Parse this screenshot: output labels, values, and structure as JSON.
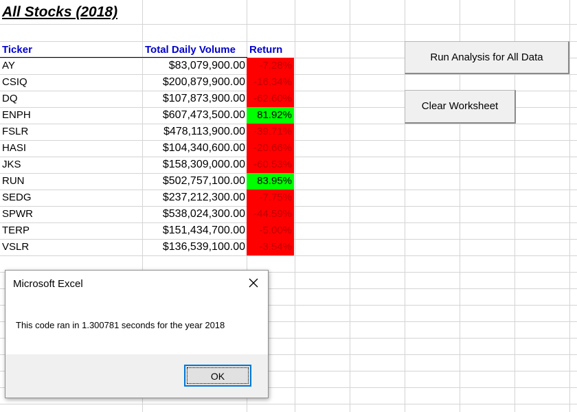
{
  "sheet": {
    "title": "All Stocks (2018)",
    "headers": {
      "ticker": "Ticker",
      "volume": "Total Daily Volume",
      "return": "Return"
    },
    "rows": [
      {
        "ticker": "AY",
        "volume": "$83,079,900.00",
        "return": "-7.28%",
        "status": "negative"
      },
      {
        "ticker": "CSIQ",
        "volume": "$200,879,900.00",
        "return": "-16.34%",
        "status": "negative"
      },
      {
        "ticker": "DQ",
        "volume": "$107,873,900.00",
        "return": "-62.60%",
        "status": "negative"
      },
      {
        "ticker": "ENPH",
        "volume": "$607,473,500.00",
        "return": "81.92%",
        "status": "positive"
      },
      {
        "ticker": "FSLR",
        "volume": "$478,113,900.00",
        "return": "-39.71%",
        "status": "negative"
      },
      {
        "ticker": "HASI",
        "volume": "$104,340,600.00",
        "return": "-20.66%",
        "status": "negative"
      },
      {
        "ticker": "JKS",
        "volume": "$158,309,000.00",
        "return": "-60.53%",
        "status": "negative"
      },
      {
        "ticker": "RUN",
        "volume": "$502,757,100.00",
        "return": "83.95%",
        "status": "positive"
      },
      {
        "ticker": "SEDG",
        "volume": "$237,212,300.00",
        "return": "-7.75%",
        "status": "negative"
      },
      {
        "ticker": "SPWR",
        "volume": "$538,024,300.00",
        "return": "-44.59%",
        "status": "negative"
      },
      {
        "ticker": "TERP",
        "volume": "$151,434,700.00",
        "return": "-5.00%",
        "status": "negative"
      },
      {
        "ticker": "VSLR",
        "volume": "$136,539,100.00",
        "return": "-3.54%",
        "status": "negative"
      }
    ]
  },
  "buttons": {
    "run_label": "Run Analysis for All Data",
    "clear_label": "Clear Worksheet"
  },
  "dialog": {
    "title": "Microsoft Excel",
    "message": "This code ran in 1.300781 seconds for the year 2018",
    "ok_label": "OK",
    "close_icon": "close-icon"
  },
  "colors": {
    "header_text": "#0000cc",
    "negative_fill": "#ff0000",
    "positive_fill": "#00ff00",
    "negative_text": "#c00000",
    "positive_text": "#000000",
    "ok_focus_border": "#0078d7"
  }
}
